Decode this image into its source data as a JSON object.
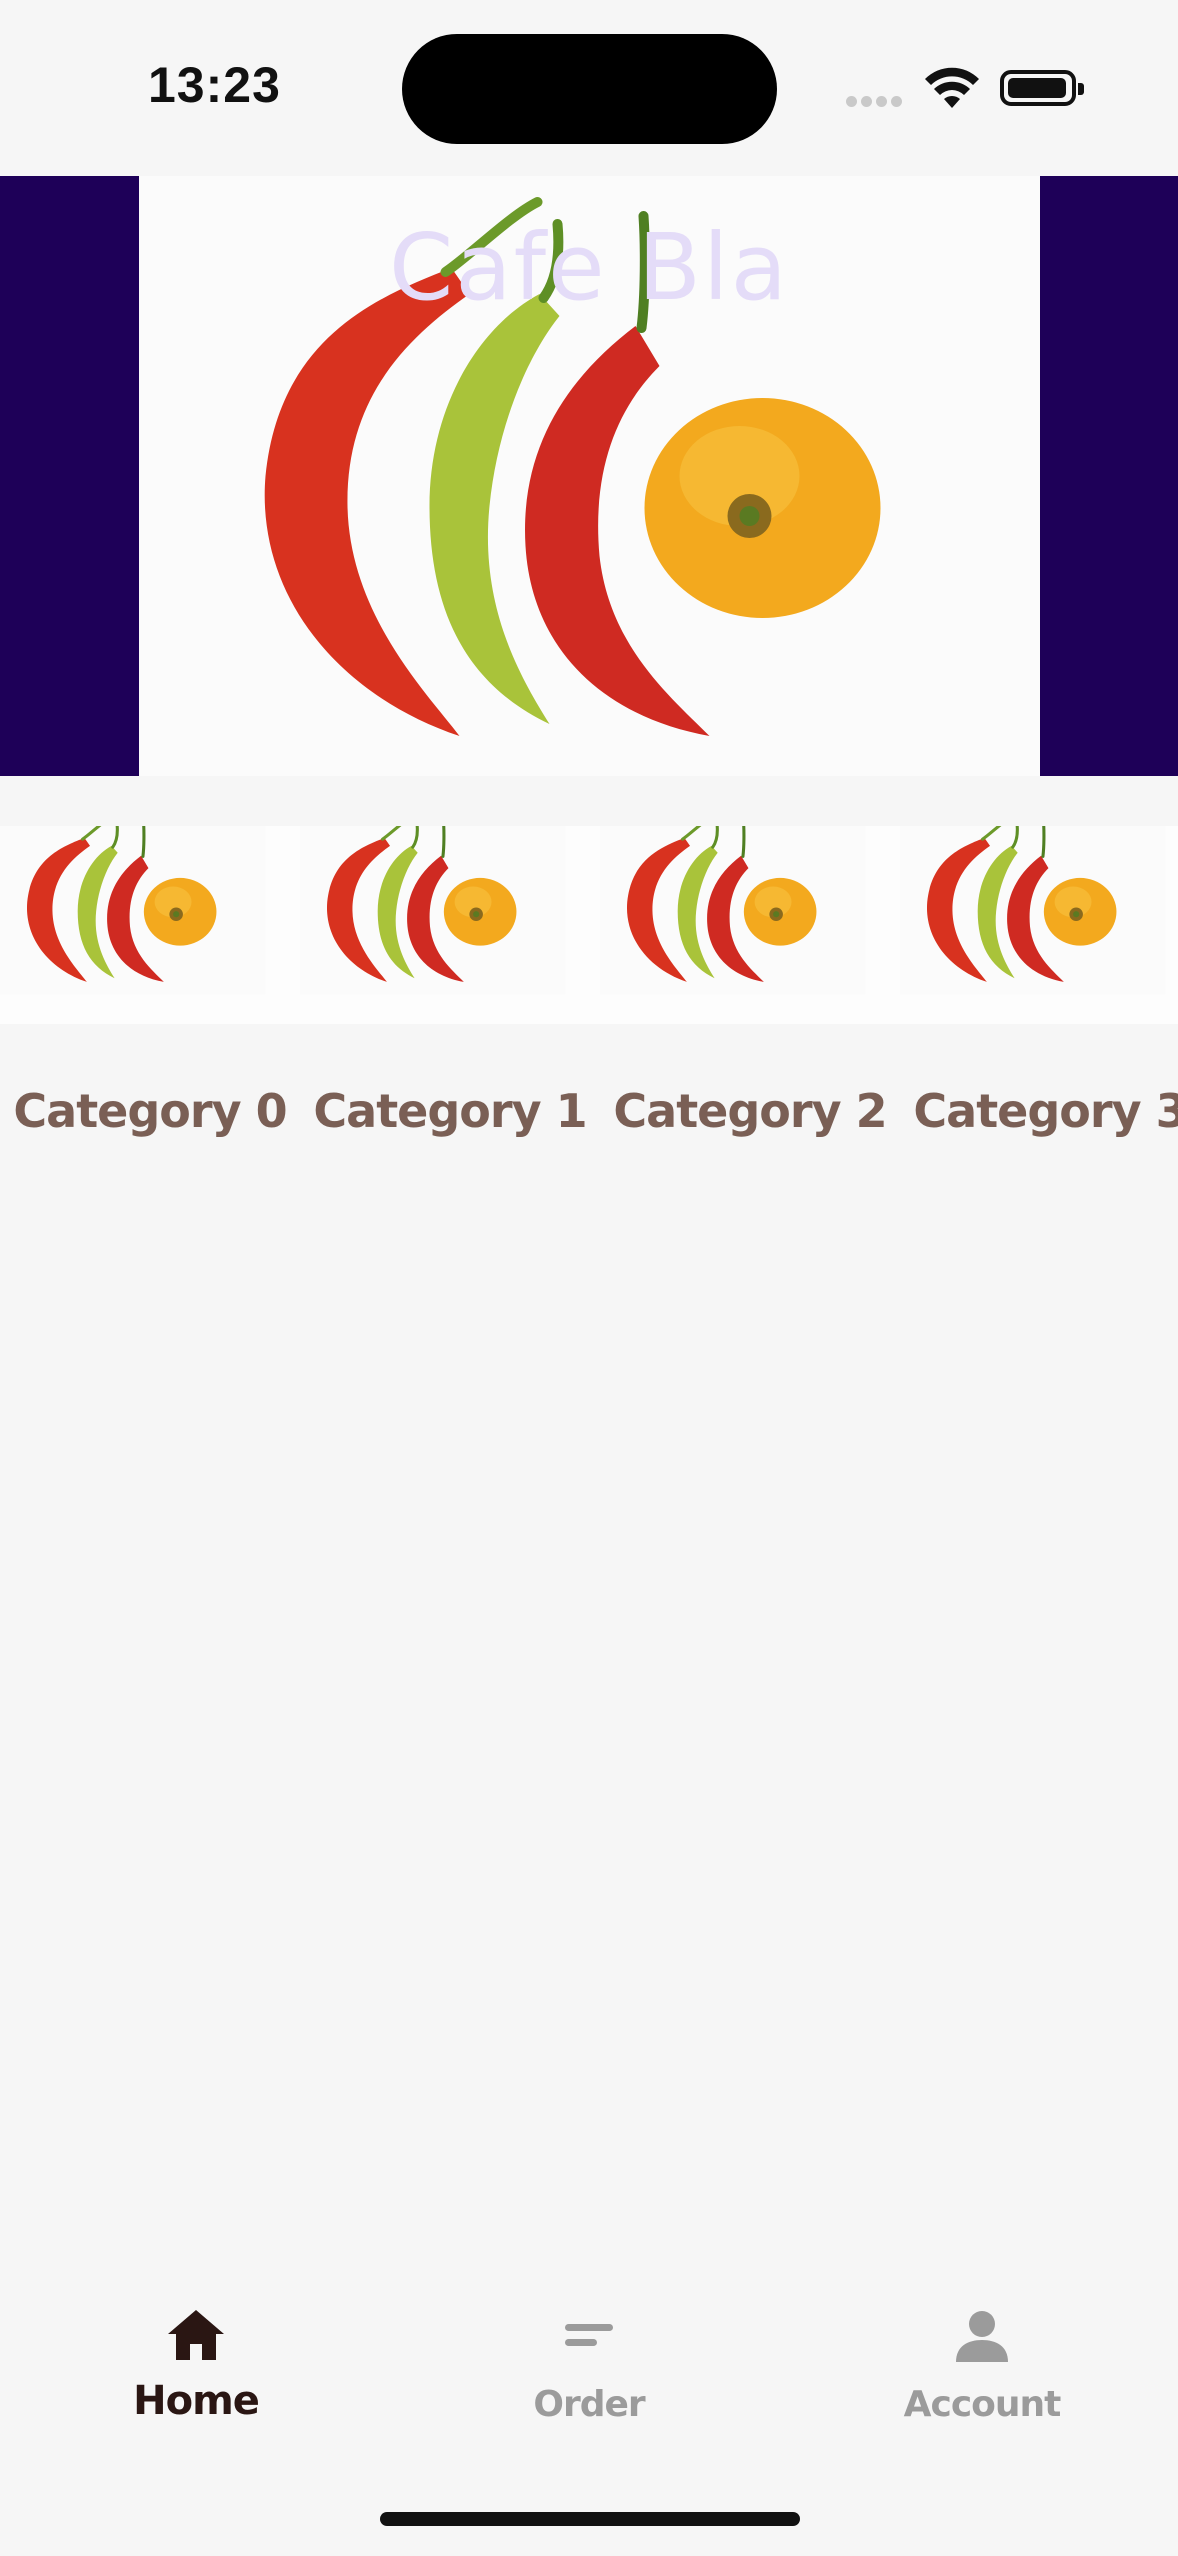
{
  "status_bar": {
    "time": "13:23"
  },
  "hero": {
    "title": "Cafe Bla",
    "image_icon": "peppers-image",
    "side_color": "#1e0058"
  },
  "categories": [
    {
      "label": "Category 0",
      "image_icon": "peppers-image"
    },
    {
      "label": "Category 1",
      "image_icon": "peppers-image"
    },
    {
      "label": "Category 2",
      "image_icon": "peppers-image"
    },
    {
      "label": "Category 3",
      "image_icon": "peppers-image"
    }
  ],
  "bottom_nav": {
    "items": [
      {
        "label": "Home",
        "icon": "home-icon",
        "active": true
      },
      {
        "label": "Order",
        "icon": "order-icon",
        "active": false
      },
      {
        "label": "Account",
        "icon": "person-icon",
        "active": false
      }
    ]
  },
  "colors": {
    "accent_text": "#7a5f55",
    "active_nav": "#2a1613",
    "inactive_nav": "#9b9b9b"
  }
}
